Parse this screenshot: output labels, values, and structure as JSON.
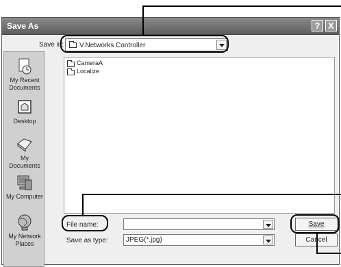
{
  "dialog": {
    "title": "Save As",
    "help_glyph": "?",
    "close_glyph": "X"
  },
  "save_in": {
    "label": "Save in:",
    "value": "V.Networks Controller"
  },
  "toolbar": {
    "back_glyph": "⇦",
    "up_glyph": "⬑",
    "new_folder_glyph": "✳",
    "views_glyph": "▦▾"
  },
  "places": [
    {
      "label": "My Recent Documents",
      "icon": "recent-documents-icon"
    },
    {
      "label": "Desktop",
      "icon": "desktop-icon"
    },
    {
      "label": "My Documents",
      "icon": "my-documents-icon"
    },
    {
      "label": "My Computer",
      "icon": "my-computer-icon"
    },
    {
      "label": "My Network Places",
      "icon": "network-places-icon"
    }
  ],
  "files": [
    {
      "name": "CameraA",
      "icon": "folder-icon"
    },
    {
      "name": "Localize",
      "icon": "folder-icon"
    }
  ],
  "file_name": {
    "label": "File name:",
    "value": ""
  },
  "save_as_type": {
    "label": "Save as type:",
    "value": "JPEG(*.jpg)"
  },
  "buttons": {
    "save": "Save",
    "cancel": "Cancel"
  },
  "colors": {
    "titlebar": "#6e6e6e",
    "dialog_bg": "#efefef",
    "callout": "#000000"
  }
}
